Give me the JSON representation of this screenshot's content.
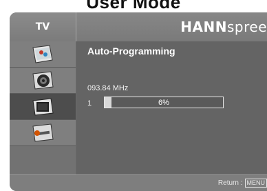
{
  "page_heading": "User Mode",
  "header": {
    "tab_label": "TV",
    "brand_bold": "HANN",
    "brand_light": "spree"
  },
  "sidebar": {
    "items": [
      {
        "icon": "picture-icon",
        "active": false
      },
      {
        "icon": "speaker-icon",
        "active": false
      },
      {
        "icon": "tv-icon",
        "active": true
      },
      {
        "icon": "wrench-icon",
        "active": false
      }
    ]
  },
  "main": {
    "title": "Auto-Programming",
    "frequency": "093.84 MHz",
    "channel": "1",
    "progress_text": "6%",
    "progress_fraction": 0.06
  },
  "footer": {
    "return_label": "Return :",
    "return_key": "MENU"
  },
  "colors": {
    "panel": "#646464",
    "sidebar_active": "#4d4d4d",
    "header": "#878787"
  }
}
